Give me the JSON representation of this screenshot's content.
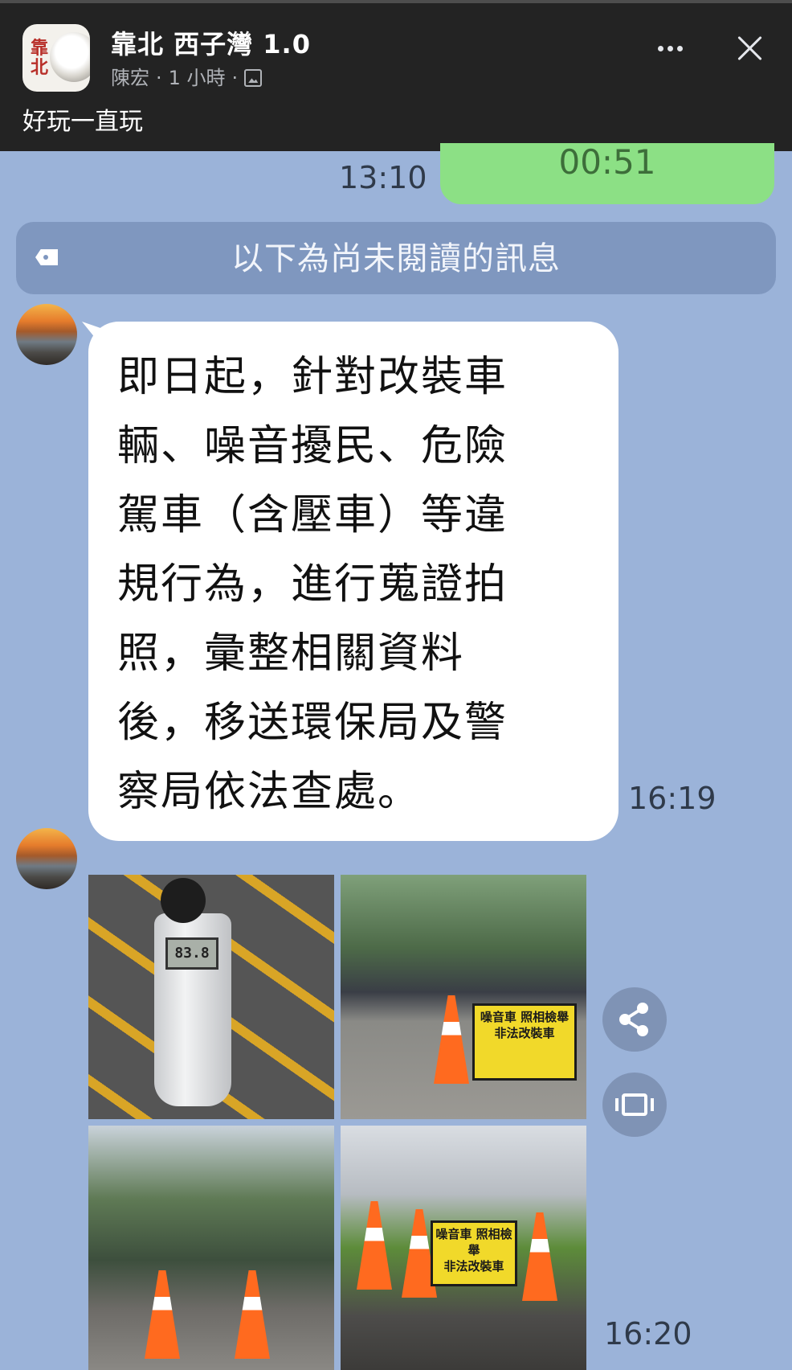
{
  "post_header": {
    "group_name": "靠北 西子灣 1.0",
    "author": "陳宏",
    "separator_1": "·",
    "time_ago": "1 小時",
    "separator_2": "·",
    "post_text": "好玩一直玩",
    "avatar_calligraphy": "靠北"
  },
  "chat": {
    "my_message_text": "00:51",
    "my_message_time": "13:10",
    "unread_banner": "以下為尚未閱讀的訊息",
    "message_text": "即日起，針對改裝車\n輛、噪音擾民、危險\n駕車（含壓車）等違\n規行為，進行蒐證拍\n照，彙整相關資料\n後，移送環保局及警\n察局依法查處。",
    "message_time": "16:19",
    "photos_time": "16:20",
    "photo_meter_reading": "83.8",
    "photo_sign_text_1": "噪音車 照相檢舉\n非法改裝車",
    "photo_sign_text_2": "噪音車 照相檢舉\n非法改裝車"
  },
  "colors": {
    "chat_background": "#9bb3d9",
    "header_background": "#232323",
    "my_bubble": "#8ce085",
    "incoming_bubble": "#ffffff",
    "unread_banner": "#7f97bf"
  },
  "icons": {
    "more": "more-horizontal-icon",
    "close": "close-icon",
    "album": "photo-album-icon",
    "tag": "tag-icon",
    "share": "share-icon",
    "expand": "expand-icon"
  }
}
